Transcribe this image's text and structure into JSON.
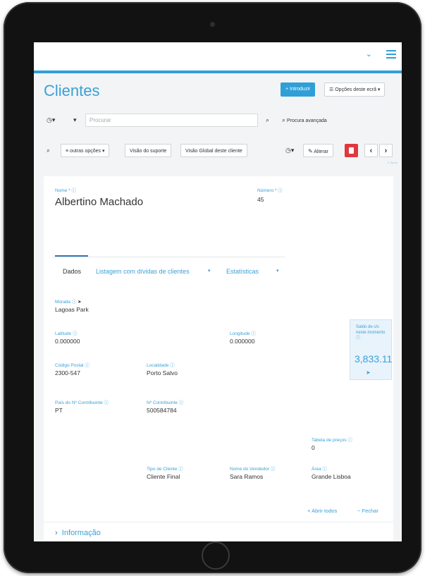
{
  "page": {
    "title": "Clientes",
    "btn_introduzir": "+ Introduzir",
    "btn_opcoes_ecra": "Opções deste ecrã ▾",
    "search_placeholder": "Procurar",
    "btn_procura_avancada": "Procura avançada",
    "btn_outras_opcoes": "outras opções ▾",
    "btn_visao_suporte": "Visão do suporte",
    "btn_visao_global": "Visão Global deste cliente",
    "btn_alterar": "Alterar",
    "small_link": "P. Ajuda"
  },
  "record": {
    "nome_label": "Nome *",
    "nome": "Albertino Machado",
    "numero_label": "Número *",
    "numero": "45",
    "saldo_label": "Saldo de c/c neste momento",
    "saldo": "3,833.11"
  },
  "tabs": [
    {
      "label": "Dados"
    },
    {
      "label": "Listagem com dívidas de clientes"
    },
    {
      "label": "Estatísticas"
    }
  ],
  "fields": {
    "morada_label": "Morada",
    "morada": "Lagoas Park",
    "latitude_label": "Latitude",
    "latitude": "0.000000",
    "longitude_label": "Longitude",
    "longitude": "0.000000",
    "codigo_postal_label": "Código Postal",
    "codigo_postal": "2300-547",
    "localidade_label": "Localidade",
    "localidade": "Porto Salvo",
    "pais_label": "País do Nº Contribuinte",
    "pais": "PT",
    "contribuinte_label": "Nº Contribuinte",
    "contribuinte": "500584784",
    "tabela_precos_label": "Tabela de preços",
    "tabela_precos": "0",
    "tipo_cliente_label": "Tipo de Cliente",
    "tipo_cliente": "Cliente Final",
    "vendedor_label": "Nome do Vendedor",
    "vendedor": "Sara Ramos",
    "area_label": "Área",
    "area": "Grande Lisboa"
  },
  "footer": {
    "abrir_todos": "Abrir todos",
    "fechar": "Fechar",
    "informacao": "Informação"
  },
  "colors": {
    "accent": "#2f9fd8",
    "danger": "#e0383e"
  }
}
